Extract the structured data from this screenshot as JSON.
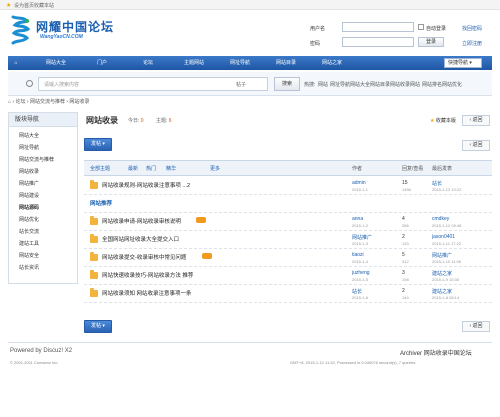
{
  "topbar": {
    "link1": "设为首页",
    "link2": "收藏本站"
  },
  "logo": {
    "title": "网耀中国论坛",
    "subtitle": "WangYaoCN.COM"
  },
  "login": {
    "user_label": "用户名",
    "pass_label": "密码",
    "auto_login": "自动登录",
    "forgot": "找回密码",
    "login_button": "登录",
    "register": "立即注册"
  },
  "nav": {
    "items": [
      "网站大全",
      "门户",
      "论坛",
      "主题网站",
      "网址导航",
      "网站目录",
      "网站之家"
    ],
    "quick": "快捷导航"
  },
  "search": {
    "placeholder": "请输入搜索内容",
    "scope": "帖子",
    "button": "搜索",
    "hot_label": "热搜:",
    "hot": [
      "网站",
      "网址导航",
      "网站大全",
      "网站目录",
      "网站收录",
      "网站",
      "网站排名",
      "网站优化"
    ]
  },
  "breadcrumb": {
    "home": "⌂",
    "sep": "›",
    "items": [
      "论坛",
      "网站交流与推荐",
      "网站收录"
    ]
  },
  "sidebar": {
    "title": "版块导航",
    "items": [
      "网站大全",
      "网址导航",
      "网站交流与推荐",
      "网站收录",
      "网站推广",
      "网站建设",
      "网站源码",
      "网站优化",
      "站长交流",
      "建站工具",
      "网站安全",
      "站长资讯"
    ]
  },
  "forum": {
    "title": "网站收录",
    "today_label": "今日:",
    "today": "0",
    "topics_label": "主题:",
    "topics": "6",
    "fav": "收藏本版",
    "back": "返回"
  },
  "toolbar": {
    "post": "发帖",
    "page": "返回"
  },
  "thread_head": {
    "all": "全部主题",
    "newest": "最新",
    "hot": "热门",
    "digest": "精华",
    "more": "更多",
    "author": "作者",
    "replies": "回复/查看",
    "last": "最后发表"
  },
  "threads": [
    {
      "title": "网站收录规则-网站收录注意事项 ...2",
      "author": "admin",
      "adate": "2015-1-1",
      "replies": "15",
      "views": "1456",
      "last_user": "站长",
      "last_date": "2015-1-12 10:22",
      "badge": false
    },
    {
      "title": "网站推荐",
      "author": "",
      "adate": "",
      "replies": "",
      "views": "",
      "last_user": "",
      "last_date": "",
      "badge": false,
      "section": true
    },
    {
      "title": "网站收录申请-网站收录审核说明",
      "author": "anna",
      "adate": "2015-1-2",
      "replies": "4",
      "views": "286",
      "last_user": "cmdkey",
      "last_date": "2015-1-12 09:48",
      "badge": true
    },
    {
      "title": "全国网站网址收录大全提交入口",
      "author": "网站推广",
      "adate": "2015-1-3",
      "replies": "2",
      "views": "133",
      "last_user": "jason0401",
      "last_date": "2015-1-11 17:22",
      "badge": false
    },
    {
      "title": "网站收录提交-收录审核中常见问题",
      "author": "tiaozi",
      "adate": "2015-1-4",
      "replies": "5",
      "views": "312",
      "last_user": "网站推广",
      "last_date": "2015-1-10 11:06",
      "badge": true
    },
    {
      "title": "网站快速收录技巧-网站收录方法 推荐",
      "author": "juzheng",
      "adate": "2015-1-5",
      "replies": "3",
      "views": "198",
      "last_user": "建站之家",
      "last_date": "2015-1-9 15:30",
      "badge": false
    },
    {
      "title": "网站收录须知 网站收录注意事项一条",
      "author": "站长",
      "adate": "2015-1-6",
      "replies": "2",
      "views": "144",
      "last_user": "建站之家",
      "last_date": "2015-1-8 08:14",
      "badge": false
    }
  ],
  "footer": {
    "powered": "Powered by Discuz! X2",
    "copyright": "© 2001-2011 Comsenz Inc.",
    "archiver": "Archiver",
    "site": "网站收录中国论坛",
    "stats": "GMT+8, 2015-1-12 11:32, Processed in 0.040076 second(s), 7 queries."
  },
  "colors": {
    "nav_blue": "#2a62b4",
    "link": "#1a5fb0",
    "accent": "#f29a1d"
  }
}
